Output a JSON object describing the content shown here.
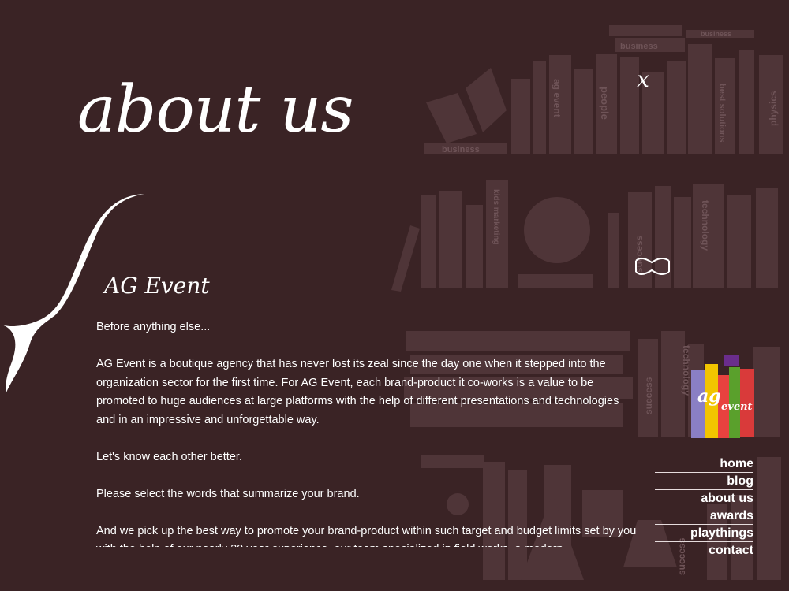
{
  "header": {
    "title": "about us",
    "close_glyph": "x"
  },
  "background": {
    "spine_labels": [
      "business",
      "business",
      "business",
      "ag event",
      "people",
      "best solutions",
      "physics",
      "kids marketing",
      "success",
      "technology",
      "success",
      "technology",
      "success"
    ],
    "color": "#3a2325"
  },
  "content": {
    "heading": "AG Event",
    "paragraphs": [
      "Before anything else...",
      "AG Event is a boutique agency that has never lost its zeal since the day one when it stepped into the organization sector for the first time. For AG Event, each brand-product it co-works is a value to be promoted to huge audiences at large platforms with the help of different presentations and technologies and in an impressive and unforgettable way.",
      "Let's know each other better.",
      "Please select the words that summarize your brand.",
      "And we pick up the best way to promote your brand-product within such target and budget limits set by you with the help of our nearly 20 year experience, our team specialized in field works, a modern"
    ]
  },
  "logo": {
    "text_ag": "ag",
    "text_event": "event",
    "colors": [
      "#8a7fc4",
      "#f2c500",
      "#e8423f",
      "#5aa02c",
      "#6a2d8c",
      "#d93a3a"
    ]
  },
  "nav": {
    "items": [
      "home",
      "blog",
      "about us",
      "awards",
      "playthings",
      "contact"
    ]
  }
}
